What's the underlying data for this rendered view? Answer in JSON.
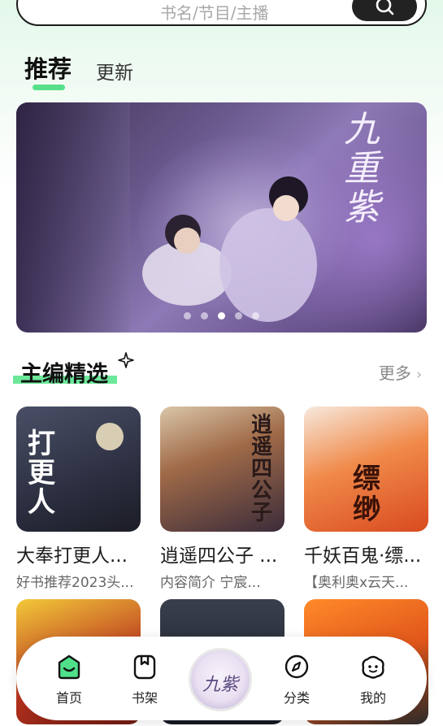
{
  "search": {
    "placeholder": "书名/节目/主播"
  },
  "tabs": [
    {
      "label": "推荐",
      "active": true
    },
    {
      "label": "更新",
      "active": false
    }
  ],
  "banner": {
    "title": "九重紫",
    "dots_total": 5,
    "active_dot": 3
  },
  "section": {
    "title": "主编精选",
    "more_label": "更多"
  },
  "books": [
    {
      "title": "大奉打更人...",
      "desc": "好书推荐2023头...",
      "cover_text": "打更人"
    },
    {
      "title": "逍遥四公子 ...",
      "desc": "内容简介 宁宸...",
      "cover_text": "逍遥四公子"
    },
    {
      "title": "千妖百鬼·缥...",
      "desc": "【奥利奥x云天...",
      "cover_text": "缥缈"
    },
    {
      "title": "",
      "desc": "",
      "cover_text": ""
    },
    {
      "title": "",
      "desc": "",
      "cover_text": ""
    },
    {
      "title": "",
      "desc": "",
      "cover_text": ""
    }
  ],
  "bottom_nav": {
    "items": [
      {
        "label": "首页",
        "icon": "home-icon",
        "active": true
      },
      {
        "label": "书架",
        "icon": "bookshelf-icon",
        "active": false
      },
      {
        "label": "分类",
        "icon": "compass-icon",
        "active": false
      },
      {
        "label": "我的",
        "icon": "profile-icon",
        "active": false
      }
    ],
    "center_label": "九紫"
  },
  "colors": {
    "accent": "#56e08a",
    "highlight": "#6ce89a",
    "text_primary": "#111111",
    "text_secondary": "#666666"
  }
}
